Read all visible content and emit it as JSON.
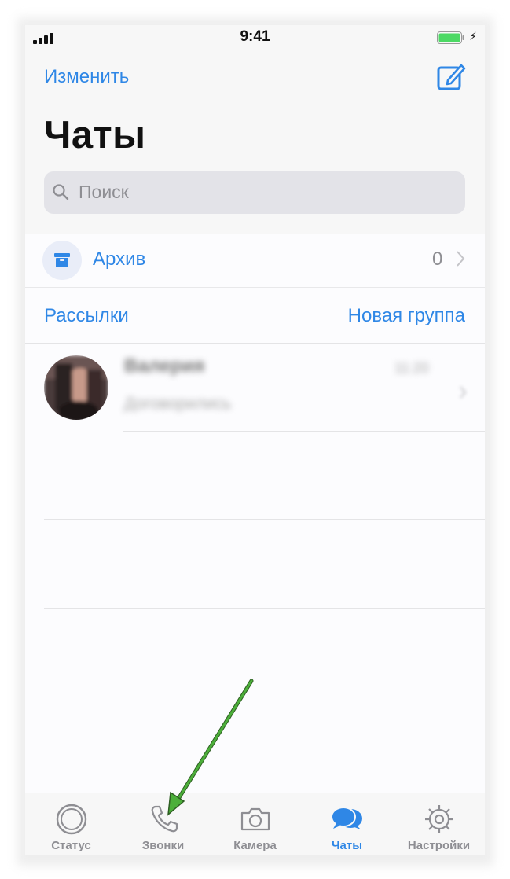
{
  "status_bar": {
    "time": "9:41"
  },
  "header": {
    "edit_label": "Изменить",
    "title": "Чаты",
    "search_placeholder": "Поиск"
  },
  "archive": {
    "label": "Архив",
    "count": "0"
  },
  "links": {
    "broadcasts": "Рассылки",
    "new_group": "Новая группа"
  },
  "chats": [
    {
      "name": "Валерия",
      "time": "11:20",
      "message": "Договорились"
    }
  ],
  "tabbar": {
    "items": [
      {
        "label": "Статус",
        "icon": "status-icon"
      },
      {
        "label": "Звонки",
        "icon": "phone-icon"
      },
      {
        "label": "Камера",
        "icon": "camera-icon"
      },
      {
        "label": "Чаты",
        "icon": "chat-bubbles-icon",
        "active": true
      },
      {
        "label": "Настройки",
        "icon": "gear-icon"
      }
    ]
  },
  "colors": {
    "accent": "#2f87e6",
    "annotation_arrow": "#4caf3a",
    "battery": "#4cd964"
  }
}
